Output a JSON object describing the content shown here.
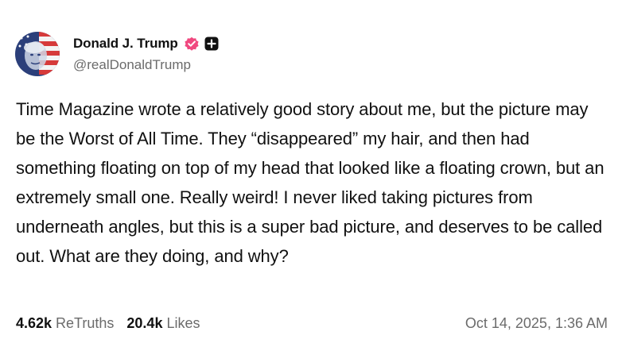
{
  "author": {
    "display_name": "Donald J. Trump",
    "handle": "@realDonaldTrump",
    "avatar_icon": "avatar-flag-portrait",
    "verified_icon": "verified-badge-icon",
    "verified_color": "#f0487f",
    "plus_icon": "plus-box-icon"
  },
  "post": {
    "text": "Time Magazine wrote a relatively good story about me, but the picture may be the Worst of All Time. They “disappeared” my hair, and then had something floating on top of my head that looked like a floating crown, but an extremely small one. Really weird! I never liked taking pictures from underneath angles, but this is a super bad picture, and deserves to be called out. What are they doing, and why?"
  },
  "stats": {
    "retruths_count": "4.62k",
    "retruths_label": "ReTruths",
    "likes_count": "20.4k",
    "likes_label": "Likes"
  },
  "timestamp": "Oct 14, 2025, 1:36 AM",
  "colors": {
    "text": "#111111",
    "muted": "#6b6b6b",
    "background": "#ffffff"
  }
}
